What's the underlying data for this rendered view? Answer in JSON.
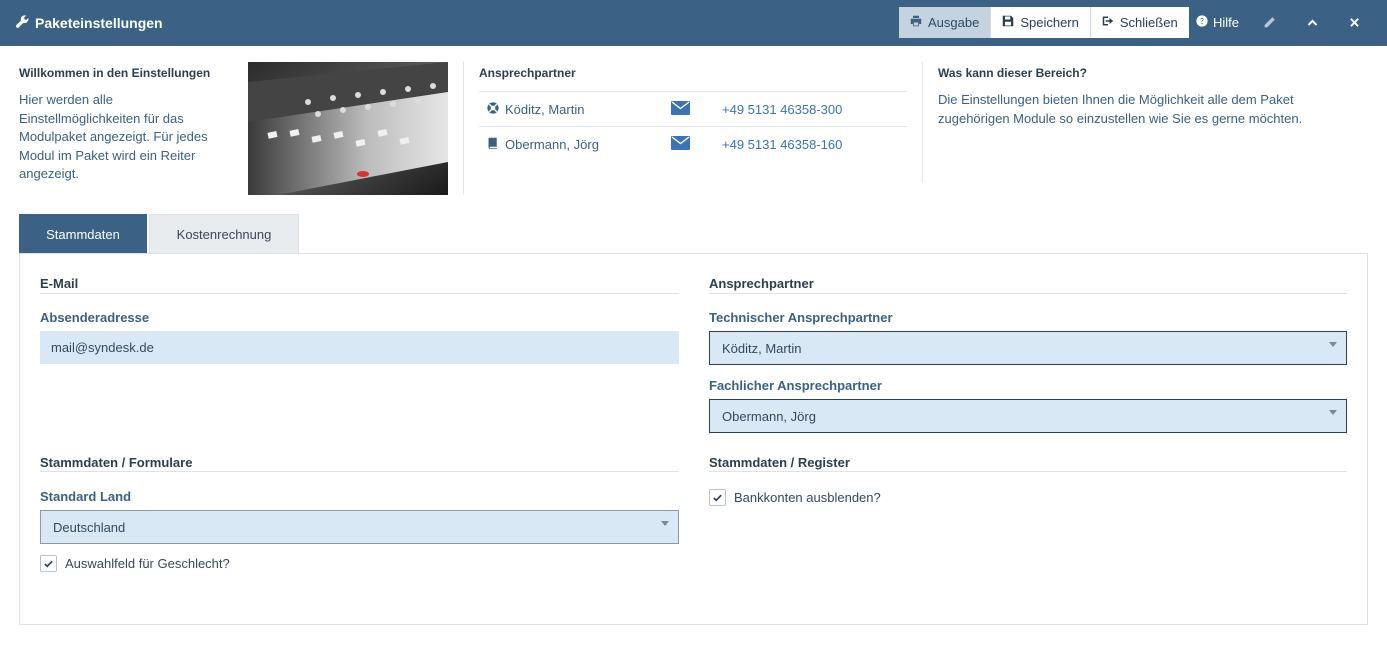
{
  "window": {
    "title": "Paketeinstellungen"
  },
  "toolbar": {
    "ausgabe_label": "Ausgabe",
    "speichern_label": "Speichern",
    "schliessen_label": "Schließen",
    "hilfe_label": "Hilfe"
  },
  "info": {
    "welcome_title": "Willkommen in den Einstellungen",
    "welcome_text": "Hier werden alle Einstellmöglichkeiten für das Modulpaket angezeigt. Für jedes Modul im Paket wird ein Reiter angezeigt.",
    "contacts_title": "Ansprechpartner",
    "contacts": [
      {
        "name": "Köditz, Martin",
        "phone": "+49 5131 46358-300",
        "icon": "lifebuoy-icon"
      },
      {
        "name": "Obermann, Jörg",
        "phone": "+49 5131 46358-160",
        "icon": "book-icon"
      }
    ],
    "what_title": "Was kann dieser Bereich?",
    "what_text": "Die Einstellungen bieten Ihnen die Möglichkeit alle dem Paket zugehörigen Module so einzustellen wie Sie es gerne möchten."
  },
  "tabs": [
    {
      "label": "Stammdaten",
      "active": true
    },
    {
      "label": "Kostenrechnung",
      "active": false
    }
  ],
  "email_section": {
    "title": "E-Mail",
    "sender_label": "Absenderadresse",
    "sender_value": "mail@syndesk.de"
  },
  "contact_section": {
    "title": "Ansprechpartner",
    "technical_label": "Technischer Ansprechpartner",
    "technical_value": "Köditz, Martin",
    "functional_label": "Fachlicher Ansprechpartner",
    "functional_value": "Obermann, Jörg"
  },
  "forms_section": {
    "title": "Stammdaten / Formulare",
    "country_label": "Standard Land",
    "country_value": "Deutschland",
    "gender_checkbox_label": "Auswahlfeld für Geschlecht?",
    "gender_checked": true
  },
  "register_section": {
    "title": "Stammdaten / Register",
    "bank_checkbox_label": "Bankkonten ausblenden?",
    "bank_checked": true
  },
  "colors": {
    "header_bg": "#3b6185",
    "input_bg": "#d8e9f5",
    "link": "#3b73b4"
  }
}
